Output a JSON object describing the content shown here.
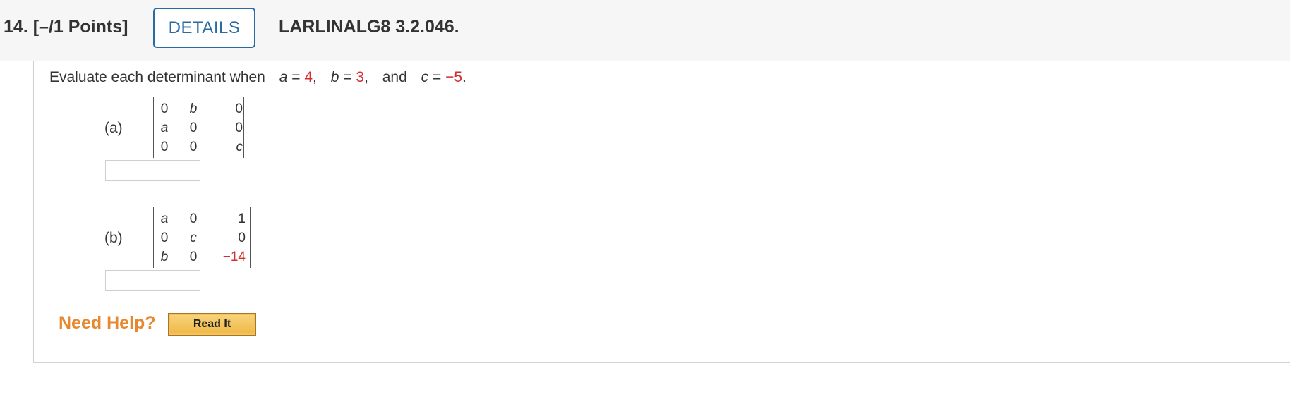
{
  "header": {
    "question_number": "14.  [–/1 Points]",
    "details_label": "DETAILS",
    "problem_code": "LARLINALG8 3.2.046."
  },
  "prompt": {
    "lead": "Evaluate each determinant when",
    "a_var": "a",
    "eq": "=",
    "a_val": "4",
    "b_var": "b",
    "b_val": "3",
    "and_text": "and",
    "c_var": "c",
    "c_val": "−5",
    "comma": ",",
    "period": "."
  },
  "parts": [
    {
      "label": "(a)",
      "matrix": [
        [
          "0",
          "b",
          "0"
        ],
        [
          "a",
          "0",
          "0"
        ],
        [
          "0",
          "0",
          "c"
        ]
      ],
      "answer": ""
    },
    {
      "label": "(b)",
      "matrix": [
        [
          "a",
          "0",
          "1"
        ],
        [
          "0",
          "c",
          "0"
        ],
        [
          "b",
          "0",
          "−14"
        ]
      ],
      "answer": ""
    }
  ],
  "help": {
    "need_help_label": "Need Help?",
    "read_it_label": "Read It"
  },
  "colors": {
    "accent_blue": "#2a6ba3",
    "value_red": "#d12f2f",
    "help_orange": "#e6882d",
    "button_gold": "#efb745"
  }
}
